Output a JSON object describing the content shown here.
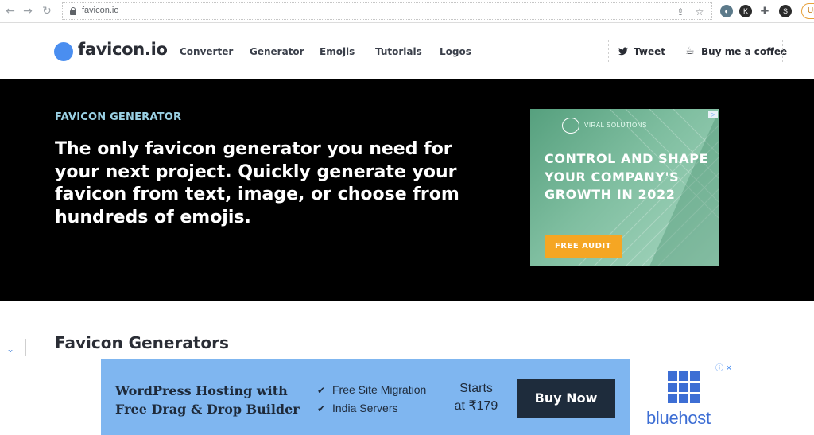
{
  "browser": {
    "url": "favicon.io",
    "update_label": "Up"
  },
  "header": {
    "logo_text": "favicon.io",
    "nav": [
      {
        "label": "Converter"
      },
      {
        "label": "Generator"
      },
      {
        "label": "Emojis"
      },
      {
        "label": "Tutorials"
      },
      {
        "label": "Logos"
      }
    ],
    "tweet_label": "Tweet",
    "coffee_label": "Buy me a coffee"
  },
  "hero": {
    "kicker": "FAVICON GENERATOR",
    "headline": "The only favicon generator you need for your next project. Quickly generate your favicon from text, image, or choose from hundreds of emojis."
  },
  "hero_ad": {
    "brand": "VIRAL SOLUTIONS",
    "headline": "CONTROL AND SHAPE YOUR COMPANY'S GROWTH IN 2022",
    "cta": "FREE AUDIT",
    "accent": "#f5a623"
  },
  "section": {
    "title": "Favicon Generators"
  },
  "banner_ad": {
    "title": "WordPress Hosting with Free Drag & Drop Builder",
    "features": [
      "Free Site Migration",
      "India Servers"
    ],
    "price_line1": "Starts",
    "price_line2": "at ₹179",
    "cta": "Buy Now",
    "brand": "bluehost",
    "bg_color": "#7fb6f0",
    "cta_color": "#1e2c3c"
  },
  "colors": {
    "logo_blue": "#4a8ef0",
    "hero_bg": "#000000",
    "kicker": "#9ad0e3",
    "bluehost": "#3d6ed4"
  }
}
